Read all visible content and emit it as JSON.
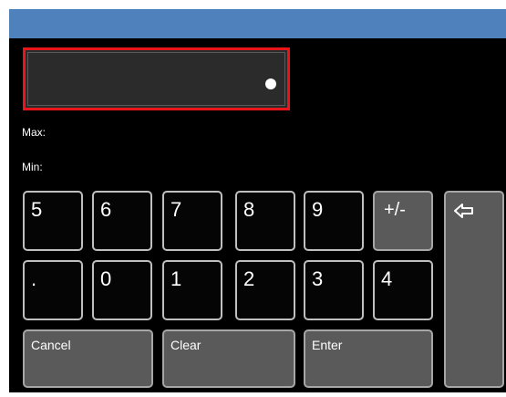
{
  "display": {
    "value": ""
  },
  "limits": {
    "max_label": "Max:",
    "max_value": "",
    "min_label": "Min:",
    "min_value": ""
  },
  "keypad": {
    "row1": [
      "5",
      "6",
      "7",
      "8",
      "9"
    ],
    "row2": [
      ".",
      "0",
      "1",
      "2",
      "3",
      "4"
    ],
    "sign_label": "+/-",
    "backspace_icon": "backspace-arrow-icon",
    "cancel_label": "Cancel",
    "clear_label": "Clear",
    "enter_label": "Enter"
  },
  "colors": {
    "title_bar": "#4f81bd",
    "background": "#000000",
    "display_border": "#e8161b",
    "key_dark": "#050505",
    "key_gray": "#5a5a5a"
  }
}
